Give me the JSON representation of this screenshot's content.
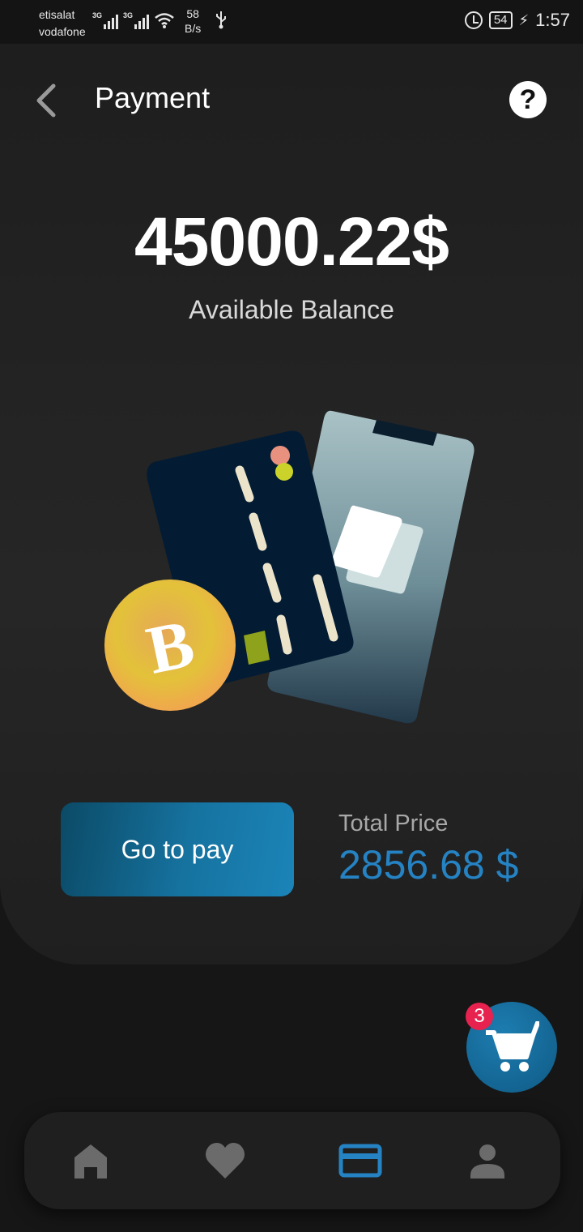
{
  "status_bar": {
    "carrier_1": "etisalat",
    "carrier_2": "vodafone",
    "network_1": "3G",
    "network_2": "3G",
    "speed_value": "58",
    "speed_unit": "B/s",
    "battery": "54",
    "time": "1:57"
  },
  "header": {
    "title": "Payment",
    "back_icon": "chevron-left-icon",
    "help_icon": "question-mark-icon",
    "help_label": "?"
  },
  "balance": {
    "amount": "45000.22$",
    "label": "Available Balance"
  },
  "illustration": {
    "coin_letter": "B"
  },
  "payment": {
    "button_label": "Go to pay",
    "total_label": "Total Price",
    "total_value": "2856.68 $"
  },
  "cart": {
    "icon": "cart-icon",
    "badge": "3"
  },
  "bottom_nav": {
    "items": [
      {
        "icon": "home-icon",
        "active": false
      },
      {
        "icon": "heart-icon",
        "active": false
      },
      {
        "icon": "credit-card-icon",
        "active": true
      },
      {
        "icon": "person-icon",
        "active": false
      }
    ]
  },
  "colors": {
    "accent": "#2583c4",
    "badge": "#e8224f",
    "nav_inactive": "#6b6b6b"
  }
}
